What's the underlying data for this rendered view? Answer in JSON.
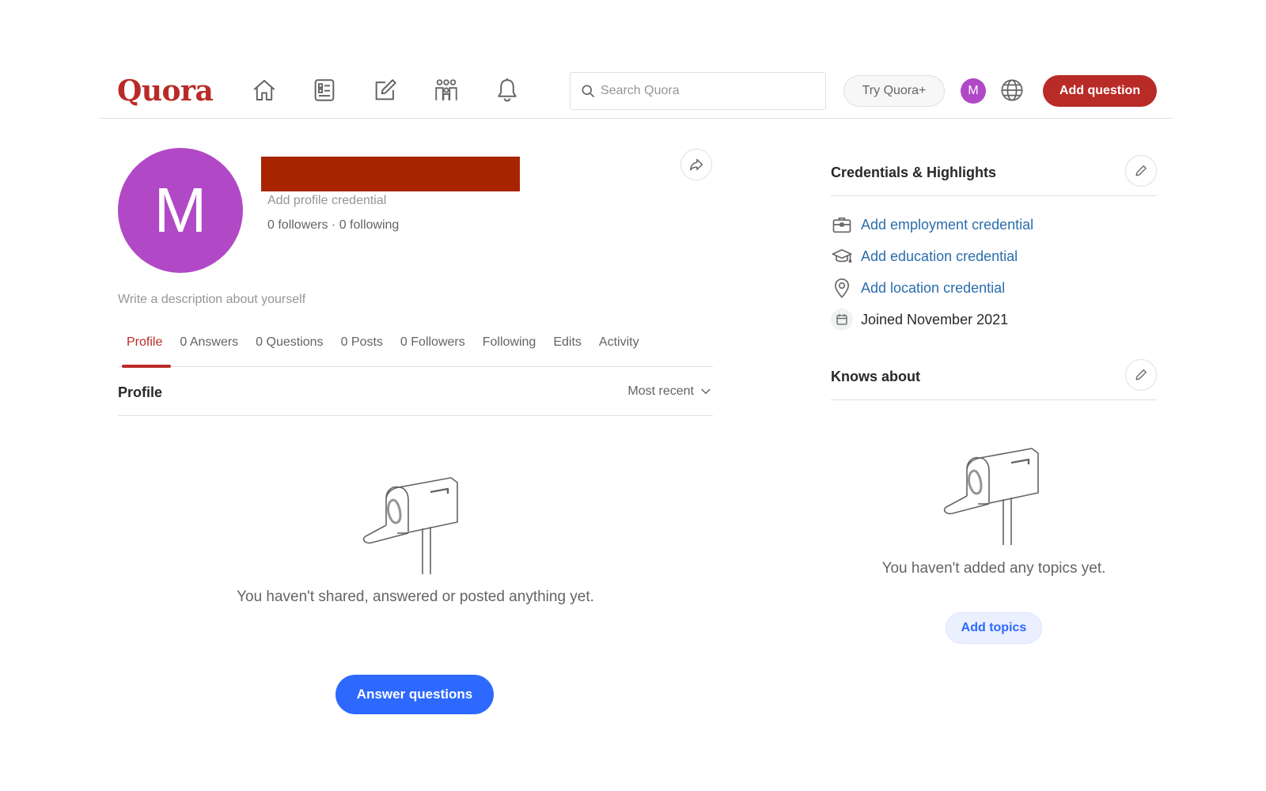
{
  "header": {
    "logo": "Quora",
    "nav_icons": [
      "home-icon",
      "following-feed-icon",
      "answer-pencil-icon",
      "spaces-icon",
      "notifications-bell-icon"
    ],
    "search_placeholder": "Search Quora",
    "try_plus": "Try Quora+",
    "avatar_initial": "M",
    "add_question": "Add question"
  },
  "profile": {
    "avatar_initial": "M",
    "add_credential": "Add profile credential",
    "followers_text": "0 followers · 0 following",
    "description_placeholder": "Write a description about yourself",
    "tabs": [
      "Profile",
      "0 Answers",
      "0 Questions",
      "0 Posts",
      "0 Followers",
      "Following",
      "Edits",
      "Activity"
    ],
    "active_tab": "Profile",
    "section_title": "Profile",
    "sort_label": "Most recent",
    "empty_text": "You haven't shared, answered or posted anything yet.",
    "answer_button": "Answer questions"
  },
  "credentials": {
    "title": "Credentials & Highlights",
    "items": [
      {
        "icon": "briefcase-icon",
        "label": "Add employment credential"
      },
      {
        "icon": "graduation-cap-icon",
        "label": "Add education credential"
      },
      {
        "icon": "location-pin-icon",
        "label": "Add location credential"
      },
      {
        "icon": "calendar-icon",
        "label": "Joined November 2021"
      }
    ]
  },
  "knows_about": {
    "title": "Knows about",
    "empty_text": "You haven't added any topics yet.",
    "add_button": "Add topics"
  },
  "colors": {
    "brand_red": "#b92b27",
    "avatar_purple": "#b149c6",
    "primary_blue": "#2e69ff",
    "link_blue": "#2b6dad",
    "redaction": "#a82400"
  }
}
